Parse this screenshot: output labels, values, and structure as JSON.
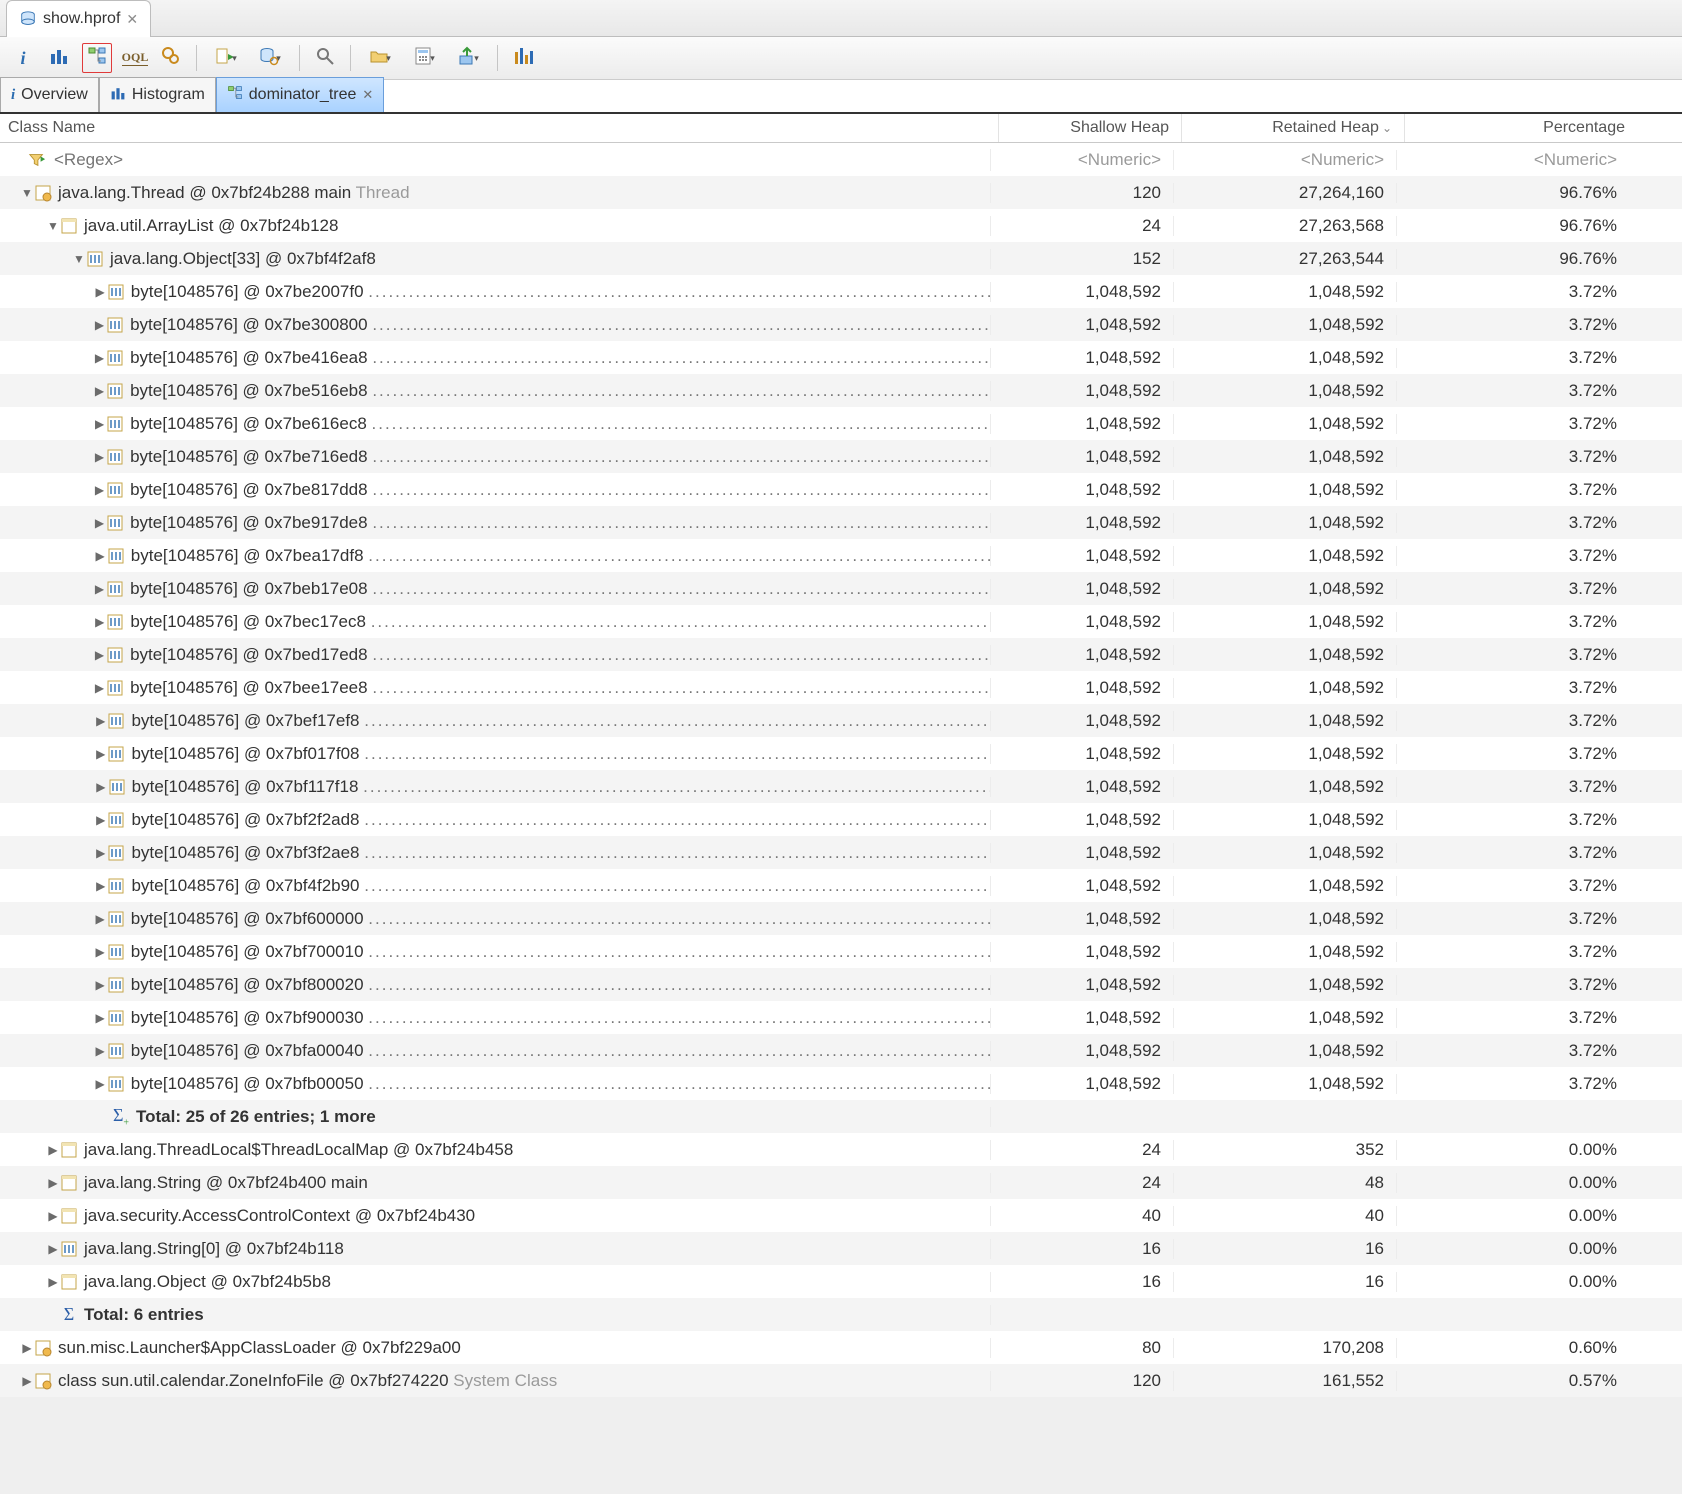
{
  "file_tab": {
    "label": "show.hprof"
  },
  "subtabs": {
    "overview": "Overview",
    "histogram": "Histogram",
    "dominator": "dominator_tree"
  },
  "columns": {
    "name": "Class Name",
    "shallow": "Shallow Heap",
    "retained": "Retained Heap",
    "percentage": "Percentage"
  },
  "filter": {
    "name_placeholder": "<Regex>",
    "numeric_placeholder": "<Numeric>"
  },
  "rows": [
    {
      "indent": 0,
      "open": true,
      "icon": "class-ref",
      "label": "java.lang.Thread @ 0x7bf24b288  main",
      "suffix": "Thread",
      "sh": "120",
      "rh": "27,264,160",
      "pc": "96.76%"
    },
    {
      "indent": 1,
      "open": true,
      "icon": "class",
      "label": "java.util.ArrayList @ 0x7bf24b128",
      "sh": "24",
      "rh": "27,263,568",
      "pc": "96.76%"
    },
    {
      "indent": 2,
      "open": true,
      "icon": "array",
      "label": "java.lang.Object[33] @ 0x7bf4f2af8",
      "sh": "152",
      "rh": "27,263,544",
      "pc": "96.76%"
    },
    {
      "indent": 3,
      "open": false,
      "icon": "array",
      "label": "byte[1048576] @ 0x7be2007f0",
      "dots": true,
      "sh": "1,048,592",
      "rh": "1,048,592",
      "pc": "3.72%"
    },
    {
      "indent": 3,
      "open": false,
      "icon": "array",
      "label": "byte[1048576] @ 0x7be300800",
      "dots": true,
      "sh": "1,048,592",
      "rh": "1,048,592",
      "pc": "3.72%"
    },
    {
      "indent": 3,
      "open": false,
      "icon": "array",
      "label": "byte[1048576] @ 0x7be416ea8",
      "dots": true,
      "sh": "1,048,592",
      "rh": "1,048,592",
      "pc": "3.72%"
    },
    {
      "indent": 3,
      "open": false,
      "icon": "array",
      "label": "byte[1048576] @ 0x7be516eb8",
      "dots": true,
      "sh": "1,048,592",
      "rh": "1,048,592",
      "pc": "3.72%"
    },
    {
      "indent": 3,
      "open": false,
      "icon": "array",
      "label": "byte[1048576] @ 0x7be616ec8",
      "dots": true,
      "sh": "1,048,592",
      "rh": "1,048,592",
      "pc": "3.72%"
    },
    {
      "indent": 3,
      "open": false,
      "icon": "array",
      "label": "byte[1048576] @ 0x7be716ed8",
      "dots": true,
      "sh": "1,048,592",
      "rh": "1,048,592",
      "pc": "3.72%"
    },
    {
      "indent": 3,
      "open": false,
      "icon": "array",
      "label": "byte[1048576] @ 0x7be817dd8",
      "dots": true,
      "sh": "1,048,592",
      "rh": "1,048,592",
      "pc": "3.72%"
    },
    {
      "indent": 3,
      "open": false,
      "icon": "array",
      "label": "byte[1048576] @ 0x7be917de8",
      "dots": true,
      "sh": "1,048,592",
      "rh": "1,048,592",
      "pc": "3.72%"
    },
    {
      "indent": 3,
      "open": false,
      "icon": "array",
      "label": "byte[1048576] @ 0x7bea17df8",
      "dots": true,
      "sh": "1,048,592",
      "rh": "1,048,592",
      "pc": "3.72%"
    },
    {
      "indent": 3,
      "open": false,
      "icon": "array",
      "label": "byte[1048576] @ 0x7beb17e08",
      "dots": true,
      "sh": "1,048,592",
      "rh": "1,048,592",
      "pc": "3.72%"
    },
    {
      "indent": 3,
      "open": false,
      "icon": "array",
      "label": "byte[1048576] @ 0x7bec17ec8",
      "dots": true,
      "sh": "1,048,592",
      "rh": "1,048,592",
      "pc": "3.72%"
    },
    {
      "indent": 3,
      "open": false,
      "icon": "array",
      "label": "byte[1048576] @ 0x7bed17ed8",
      "dots": true,
      "sh": "1,048,592",
      "rh": "1,048,592",
      "pc": "3.72%"
    },
    {
      "indent": 3,
      "open": false,
      "icon": "array",
      "label": "byte[1048576] @ 0x7bee17ee8",
      "dots": true,
      "sh": "1,048,592",
      "rh": "1,048,592",
      "pc": "3.72%"
    },
    {
      "indent": 3,
      "open": false,
      "icon": "array",
      "label": "byte[1048576] @ 0x7bef17ef8",
      "dots": true,
      "sh": "1,048,592",
      "rh": "1,048,592",
      "pc": "3.72%"
    },
    {
      "indent": 3,
      "open": false,
      "icon": "array",
      "label": "byte[1048576] @ 0x7bf017f08",
      "dots": true,
      "sh": "1,048,592",
      "rh": "1,048,592",
      "pc": "3.72%"
    },
    {
      "indent": 3,
      "open": false,
      "icon": "array",
      "label": "byte[1048576] @ 0x7bf117f18",
      "dots": true,
      "sh": "1,048,592",
      "rh": "1,048,592",
      "pc": "3.72%"
    },
    {
      "indent": 3,
      "open": false,
      "icon": "array",
      "label": "byte[1048576] @ 0x7bf2f2ad8",
      "dots": true,
      "sh": "1,048,592",
      "rh": "1,048,592",
      "pc": "3.72%"
    },
    {
      "indent": 3,
      "open": false,
      "icon": "array",
      "label": "byte[1048576] @ 0x7bf3f2ae8",
      "dots": true,
      "sh": "1,048,592",
      "rh": "1,048,592",
      "pc": "3.72%"
    },
    {
      "indent": 3,
      "open": false,
      "icon": "array",
      "label": "byte[1048576] @ 0x7bf4f2b90",
      "dots": true,
      "sh": "1,048,592",
      "rh": "1,048,592",
      "pc": "3.72%"
    },
    {
      "indent": 3,
      "open": false,
      "icon": "array",
      "label": "byte[1048576] @ 0x7bf600000",
      "dots": true,
      "sh": "1,048,592",
      "rh": "1,048,592",
      "pc": "3.72%"
    },
    {
      "indent": 3,
      "open": false,
      "icon": "array",
      "label": "byte[1048576] @ 0x7bf700010",
      "dots": true,
      "sh": "1,048,592",
      "rh": "1,048,592",
      "pc": "3.72%"
    },
    {
      "indent": 3,
      "open": false,
      "icon": "array",
      "label": "byte[1048576] @ 0x7bf800020",
      "dots": true,
      "sh": "1,048,592",
      "rh": "1,048,592",
      "pc": "3.72%"
    },
    {
      "indent": 3,
      "open": false,
      "icon": "array",
      "label": "byte[1048576] @ 0x7bf900030",
      "dots": true,
      "sh": "1,048,592",
      "rh": "1,048,592",
      "pc": "3.72%"
    },
    {
      "indent": 3,
      "open": false,
      "icon": "array",
      "label": "byte[1048576] @ 0x7bfa00040",
      "dots": true,
      "sh": "1,048,592",
      "rh": "1,048,592",
      "pc": "3.72%"
    },
    {
      "indent": 3,
      "open": false,
      "icon": "array",
      "label": "byte[1048576] @ 0x7bfb00050",
      "dots": true,
      "sh": "1,048,592",
      "rh": "1,048,592",
      "pc": "3.72%"
    },
    {
      "indent": 3,
      "open": null,
      "icon": "sigma-plus",
      "label": "Total: 25 of 26 entries; 1 more",
      "bold": true
    },
    {
      "indent": 1,
      "open": false,
      "icon": "class",
      "label": "java.lang.ThreadLocal$ThreadLocalMap @ 0x7bf24b458",
      "sh": "24",
      "rh": "352",
      "pc": "0.00%"
    },
    {
      "indent": 1,
      "open": false,
      "icon": "class",
      "label": "java.lang.String @ 0x7bf24b400  main",
      "sh": "24",
      "rh": "48",
      "pc": "0.00%"
    },
    {
      "indent": 1,
      "open": false,
      "icon": "class",
      "label": "java.security.AccessControlContext @ 0x7bf24b430",
      "sh": "40",
      "rh": "40",
      "pc": "0.00%"
    },
    {
      "indent": 1,
      "open": false,
      "icon": "array",
      "label": "java.lang.String[0] @ 0x7bf24b118",
      "sh": "16",
      "rh": "16",
      "pc": "0.00%"
    },
    {
      "indent": 1,
      "open": false,
      "icon": "class",
      "label": "java.lang.Object @ 0x7bf24b5b8",
      "sh": "16",
      "rh": "16",
      "pc": "0.00%"
    },
    {
      "indent": 1,
      "open": null,
      "icon": "sigma",
      "label": "Total: 6 entries",
      "bold": true
    },
    {
      "indent": 0,
      "open": false,
      "icon": "class-ref",
      "label": "sun.misc.Launcher$AppClassLoader @ 0x7bf229a00",
      "sh": "80",
      "rh": "170,208",
      "pc": "0.60%"
    },
    {
      "indent": 0,
      "open": false,
      "icon": "class-ref",
      "label": "class sun.util.calendar.ZoneInfoFile @ 0x7bf274220",
      "suffix": "System Class",
      "sh": "120",
      "rh": "161,552",
      "pc": "0.57%"
    }
  ]
}
